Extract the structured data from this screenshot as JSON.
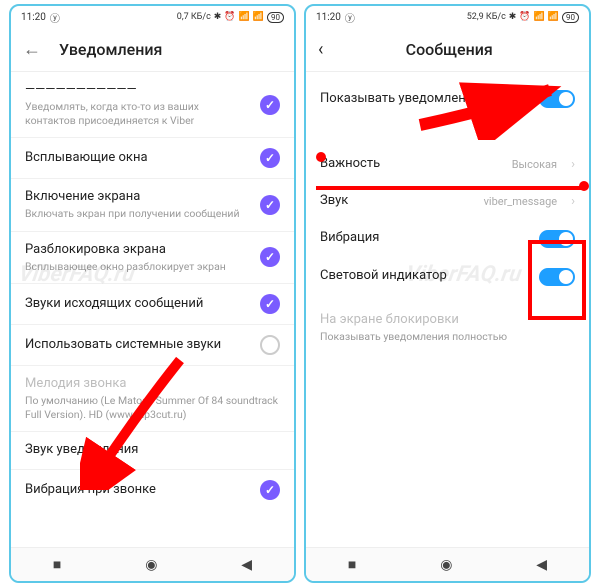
{
  "status": {
    "time": "11:20",
    "net_left": "0,7 КБ/с",
    "net_right": "52,9 КБ/с",
    "battery": "90"
  },
  "left": {
    "header": "Уведомления",
    "row0_sub": "Уведомлять, когда кто-то из ваших контактов присоединяется к Viber",
    "row1": "Всплывающие окна",
    "row2": "Включение экрана",
    "row2_sub": "Включать экран при получении сообщений",
    "row3": "Разблокировка экрана",
    "row3_sub": "Всплывающее окно разблокирует экран",
    "row4": "Звуки исходящих сообщений",
    "row5": "Использовать системные звуки",
    "row6": "Мелодия звонка",
    "row6_sub": "По умолчанию (Le Matos - Summer Of 84 soundtrack Full Version). HD (www.mp3cut.ru)",
    "row7": "Звук уведомления",
    "row8": "Вибрация при звонке"
  },
  "right": {
    "header": "Сообщения",
    "row1": "Показывать уведомления",
    "row2": "Важность",
    "row2_val": "Высокая",
    "row3": "Звук",
    "row3_val": "viber_message",
    "row4": "Вибрация",
    "row5": "Световой индикатор",
    "row6": "На экране блокировки",
    "row6_sub": "Показывать уведомления полностью"
  },
  "watermark": "ViberFAQ.ru"
}
